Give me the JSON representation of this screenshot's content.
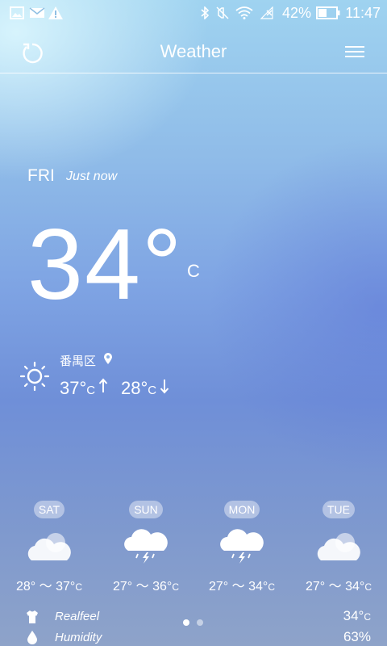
{
  "status_bar": {
    "battery_percent": "42%",
    "time": "11:47",
    "icons": [
      "gallery-icon",
      "mail-icon",
      "warning-icon",
      "bluetooth-icon",
      "mute-icon",
      "wifi-icon",
      "no-signal-icon",
      "battery-icon"
    ]
  },
  "header": {
    "title": "Weather",
    "left_icon": "refresh-icon",
    "right_icon": "menu-icon"
  },
  "current": {
    "day": "FRI",
    "updated": "Just now",
    "temperature": "34°",
    "unit": "C",
    "condition_icon": "sun-icon",
    "location": "番禺区",
    "location_icon": "location-pin-icon",
    "high": "37°",
    "high_unit": "C",
    "low": "28°",
    "low_unit": "C"
  },
  "forecast": [
    {
      "day": "SAT",
      "icon": "cloudy-icon",
      "low": "28°",
      "high": "37°",
      "unit": "C"
    },
    {
      "day": "SUN",
      "icon": "thunderstorm-icon",
      "low": "27°",
      "high": "36°",
      "unit": "C"
    },
    {
      "day": "MON",
      "icon": "thunderstorm-icon",
      "low": "27°",
      "high": "34°",
      "unit": "C"
    },
    {
      "day": "TUE",
      "icon": "cloudy-icon",
      "low": "27°",
      "high": "34°",
      "unit": "C"
    }
  ],
  "range_separator": "～",
  "details": [
    {
      "label": "Realfeel",
      "value": "34°",
      "unit": "C",
      "icon": "shirt-icon"
    },
    {
      "label": "Humidity",
      "value": "63%",
      "unit": "",
      "icon": "droplet-icon"
    }
  ],
  "pager": {
    "pages": 2,
    "active": 1
  }
}
